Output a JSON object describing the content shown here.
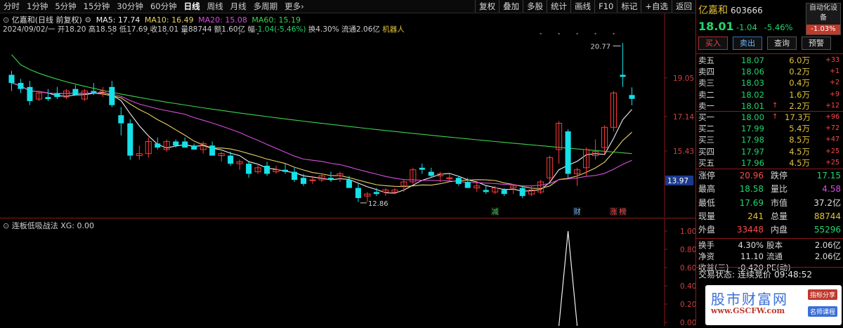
{
  "colors": {
    "up": "#ff3b3b",
    "down": "#16e0e8",
    "ma5": "#f0f0f0",
    "ma10": "#e8d264",
    "ma20": "#d94de0",
    "ma60": "#3cd24a",
    "green": "#21d66e",
    "yellow": "#e2c23c",
    "red": "#ff4a4a"
  },
  "toolbar": {
    "periods": [
      "分时",
      "1分钟",
      "5分钟",
      "15分钟",
      "30分钟",
      "60分钟",
      "日线",
      "周线",
      "月线",
      "多周期",
      "更多›"
    ],
    "active_period": "日线",
    "tools": [
      "复权",
      "叠加",
      "多股",
      "统计",
      "画线",
      "F10",
      "标记",
      "+自选",
      "返回"
    ]
  },
  "chart_info": {
    "title": "亿嘉和(日线 前复权)",
    "ma5": "MA5: 17.74",
    "ma10": "MA10: 16.49",
    "ma20": "MA20: 15.08",
    "ma60": "MA60: 15.19",
    "line2_prefix": "2024/09/02/一 开18.20 高18.58 低17.69 收18.01 量88744 额1.60亿 幅",
    "line2_change": "-1.04(-5.46%)",
    "line2_suffix": "换4.30% 流通2.06亿",
    "robot": "机器人"
  },
  "chart_data": {
    "type": "candlestick",
    "series": [
      {
        "name": "MA5"
      },
      {
        "name": "MA10"
      },
      {
        "name": "MA20"
      },
      {
        "name": "MA60"
      }
    ],
    "ylim": [
      12.3,
      21.2
    ],
    "y_ticks": [
      "19.05",
      "17.14",
      "15.43",
      "13.89"
    ],
    "current_price_label": "13.97",
    "high_annotation": "20.77",
    "low_annotation": "12.86",
    "event_tags": [
      "减",
      "财",
      "涨",
      "榜"
    ],
    "candles": [
      [
        19.2,
        19.4,
        18.4,
        18.8
      ],
      [
        18.8,
        19.0,
        18.3,
        18.5
      ],
      [
        18.6,
        18.9,
        17.7,
        17.9
      ],
      [
        18.0,
        18.4,
        17.9,
        18.3
      ],
      [
        18.1,
        18.5,
        17.9,
        18.0
      ],
      [
        18.3,
        18.6,
        18.0,
        18.1
      ],
      [
        18.1,
        18.5,
        18.0,
        18.4
      ],
      [
        18.5,
        18.7,
        18.2,
        18.2
      ],
      [
        18.0,
        18.5,
        17.9,
        18.4
      ],
      [
        18.4,
        18.8,
        18.2,
        18.3
      ],
      [
        18.3,
        18.6,
        18.1,
        18.4
      ],
      [
        18.6,
        18.9,
        17.6,
        17.7
      ],
      [
        17.2,
        17.6,
        16.2,
        16.8
      ],
      [
        16.8,
        17.0,
        15.0,
        15.2
      ],
      [
        15.2,
        15.7,
        15.0,
        15.3
      ],
      [
        15.3,
        16.1,
        15.1,
        15.9
      ],
      [
        15.8,
        16.1,
        15.5,
        15.6
      ],
      [
        15.5,
        16.0,
        15.4,
        15.9
      ],
      [
        15.9,
        16.0,
        15.6,
        15.7
      ],
      [
        15.9,
        16.1,
        15.6,
        15.6
      ],
      [
        15.7,
        15.8,
        15.5,
        15.5
      ],
      [
        15.5,
        15.9,
        15.3,
        15.8
      ],
      [
        15.7,
        15.9,
        15.2,
        15.2
      ],
      [
        15.2,
        15.4,
        14.9,
        15.3
      ],
      [
        15.2,
        15.4,
        14.7,
        14.8
      ],
      [
        14.8,
        15.0,
        14.5,
        14.9
      ],
      [
        14.8,
        14.9,
        14.1,
        14.3
      ],
      [
        14.4,
        14.8,
        14.3,
        14.6
      ],
      [
        14.7,
        14.9,
        14.2,
        14.3
      ],
      [
        14.4,
        14.7,
        14.3,
        14.5
      ],
      [
        14.5,
        14.8,
        14.3,
        14.4
      ],
      [
        14.4,
        14.6,
        13.9,
        14.0
      ],
      [
        14.1,
        14.3,
        13.7,
        13.8
      ],
      [
        14.0,
        14.2,
        13.8,
        14.0
      ],
      [
        14.0,
        14.3,
        13.9,
        14.2
      ],
      [
        14.1,
        14.4,
        13.9,
        14.0
      ],
      [
        14.2,
        14.4,
        13.9,
        14.3
      ],
      [
        14.0,
        14.2,
        13.6,
        13.6
      ],
      [
        13.6,
        13.8,
        12.9,
        13.1
      ],
      [
        13.2,
        13.4,
        12.9,
        13.3
      ],
      [
        13.4,
        13.6,
        13.2,
        13.3
      ],
      [
        13.4,
        13.6,
        13.2,
        13.5
      ],
      [
        13.4,
        13.6,
        13.3,
        13.5
      ],
      [
        13.7,
        14.0,
        13.4,
        13.9
      ],
      [
        13.9,
        14.6,
        13.8,
        14.5
      ],
      [
        14.6,
        14.8,
        14.3,
        14.5
      ],
      [
        14.4,
        14.6,
        14.1,
        14.2
      ],
      [
        14.2,
        14.4,
        13.9,
        14.3
      ],
      [
        14.1,
        14.3,
        13.9,
        14.1
      ],
      [
        14.1,
        14.2,
        13.7,
        13.8
      ],
      [
        13.9,
        14.1,
        13.6,
        13.6
      ],
      [
        13.6,
        13.9,
        13.4,
        13.7
      ],
      [
        13.5,
        13.7,
        13.3,
        13.4
      ],
      [
        13.4,
        13.7,
        13.3,
        13.6
      ],
      [
        13.5,
        13.6,
        13.2,
        13.3
      ],
      [
        13.6,
        13.8,
        13.3,
        13.7
      ],
      [
        13.6,
        13.7,
        13.1,
        13.2
      ],
      [
        13.3,
        13.7,
        13.2,
        13.5
      ],
      [
        13.4,
        14.0,
        13.3,
        13.9
      ],
      [
        14.1,
        15.2,
        13.9,
        15.1
      ],
      [
        15.5,
        16.9,
        14.8,
        16.8
      ],
      [
        16.4,
        16.5,
        14.1,
        14.3
      ],
      [
        14.3,
        14.6,
        13.7,
        14.5
      ],
      [
        14.6,
        15.6,
        14.2,
        15.5
      ],
      [
        15.2,
        16.0,
        15.0,
        15.4
      ],
      [
        15.6,
        16.7,
        15.3,
        16.6
      ],
      [
        16.6,
        18.4,
        16.4,
        18.3
      ],
      [
        19.2,
        20.77,
        18.6,
        19.1
      ],
      [
        18.2,
        18.58,
        17.69,
        18.01
      ]
    ]
  },
  "indicator": {
    "header": "连板低吸战法  XG: 0.00",
    "y_ticks": [
      "1.00",
      "0.80",
      "0.60",
      "0.40",
      "0.20",
      "0.00"
    ],
    "signal_index": 61
  },
  "side": {
    "name": "亿嘉和",
    "code": "603666",
    "auto_label": "自动化设备",
    "auto_pct": "-1.03%",
    "price": "18.01",
    "change": "-1.04",
    "change_pct": "-5.46%",
    "buttons": [
      "买入",
      "卖出",
      "查询",
      "预警"
    ],
    "asks": [
      {
        "label": "卖五",
        "price": "18.07",
        "vol": "6.0万",
        "chg": "+33"
      },
      {
        "label": "卖四",
        "price": "18.06",
        "vol": "0.2万",
        "chg": "+1"
      },
      {
        "label": "卖三",
        "price": "18.03",
        "vol": "0.4万",
        "chg": "+2"
      },
      {
        "label": "卖二",
        "price": "18.02",
        "vol": "1.6万",
        "chg": "+9"
      },
      {
        "label": "卖一",
        "price": "18.01",
        "vol": "2.2万",
        "chg": "+12"
      }
    ],
    "bids": [
      {
        "label": "买一",
        "price": "18.00",
        "vol": "17.3万",
        "chg": "+96"
      },
      {
        "label": "买二",
        "price": "17.99",
        "vol": "5.4万",
        "chg": "+72"
      },
      {
        "label": "买三",
        "price": "17.98",
        "vol": "8.5万",
        "chg": "+47"
      },
      {
        "label": "买四",
        "price": "17.97",
        "vol": "4.5万",
        "chg": "+25"
      },
      {
        "label": "买五",
        "price": "17.96",
        "vol": "4.5万",
        "chg": "+25"
      }
    ],
    "stats": [
      {
        "l1": "涨停",
        "v1": "20.96",
        "c1": "#ff4a4a",
        "l2": "跌停",
        "v2": "17.15",
        "c2": "#21d66e"
      },
      {
        "l1": "最高",
        "v1": "18.58",
        "c1": "#21d66e",
        "l2": "量比",
        "v2": "4.58",
        "c2": "#d94de0"
      },
      {
        "l1": "最低",
        "v1": "17.69",
        "c1": "#21d66e",
        "l2": "市值",
        "v2": "37.2亿",
        "c2": "#e0e0e0"
      },
      {
        "l1": "现量",
        "v1": "241",
        "c1": "#e2c23c",
        "l2": "总量",
        "v2": "88744",
        "c2": "#e2c23c"
      },
      {
        "l1": "外盘",
        "v1": "33448",
        "c1": "#ff4a4a",
        "l2": "内盘",
        "v2": "55296",
        "c2": "#21d66e"
      }
    ],
    "stats2": [
      {
        "l1": "换手",
        "v1": "4.30%",
        "l2": "股本",
        "v2": "2.06亿"
      },
      {
        "l1": "净资",
        "v1": "11.10",
        "l2": "流通",
        "v2": "2.06亿"
      },
      {
        "l1": "收益(三)",
        "v1": "-0.420",
        "l2": "PE(动)",
        "v2": ""
      }
    ],
    "trade_state_label": "交易状态:",
    "trade_state": "连续竞价",
    "trade_time": "09:48:52"
  },
  "watermark": {
    "title": "股市财富网",
    "site": "www.GSCFW.com",
    "tag1": "指标分享",
    "tag2": "名师课程"
  }
}
